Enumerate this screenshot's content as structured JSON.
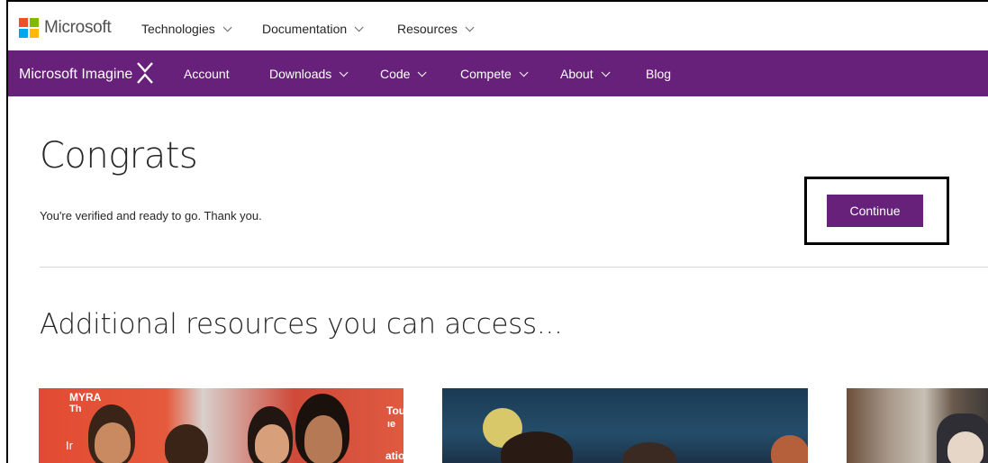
{
  "ms_header": {
    "logo_text": "Microsoft",
    "logo_colors": [
      "#f25022",
      "#7fba00",
      "#00a4ef",
      "#ffb900"
    ],
    "nav": [
      {
        "label": "Technologies"
      },
      {
        "label": "Documentation"
      },
      {
        "label": "Resources"
      }
    ]
  },
  "imagine_bar": {
    "brand": "Microsoft Imagine",
    "nav": [
      {
        "label": "Account"
      },
      {
        "label": "Downloads"
      },
      {
        "label": "Code"
      },
      {
        "label": "Compete"
      },
      {
        "label": "About"
      },
      {
        "label": "Blog"
      }
    ],
    "bar_color": "#68217a"
  },
  "main": {
    "title": "Congrats",
    "message": "You're verified and ready to go. Thank you.",
    "continue_label": "Continue",
    "subtitle": "Additional resources you can access..."
  },
  "cards": [
    {
      "overlay_lines": [
        "MYRA",
        "Th",
        "Ir"
      ],
      "overlay_right": [
        "Tou",
        "ıe",
        "atio"
      ]
    },
    {},
    {}
  ]
}
